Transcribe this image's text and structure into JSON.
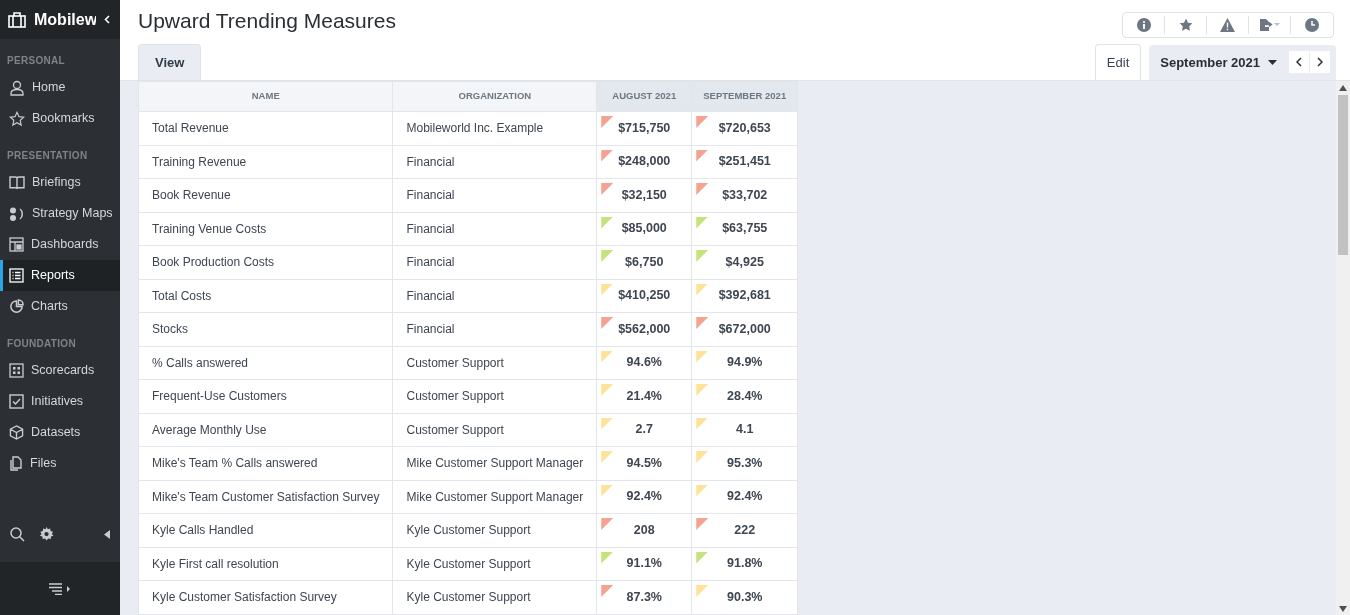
{
  "sidebar": {
    "brand": "Mobilew",
    "sections": [
      {
        "title": "PERSONAL",
        "items": [
          {
            "label": "Home",
            "selected": false
          },
          {
            "label": "Bookmarks",
            "selected": false
          }
        ]
      },
      {
        "title": "PRESENTATION",
        "items": [
          {
            "label": "Briefings",
            "selected": false
          },
          {
            "label": "Strategy Maps",
            "selected": false
          },
          {
            "label": "Dashboards",
            "selected": false
          },
          {
            "label": "Reports",
            "selected": true
          },
          {
            "label": "Charts",
            "selected": false
          }
        ]
      },
      {
        "title": "FOUNDATION",
        "items": [
          {
            "label": "Scorecards",
            "selected": false
          },
          {
            "label": "Initiatives",
            "selected": false
          },
          {
            "label": "Datasets",
            "selected": false
          },
          {
            "label": "Files",
            "selected": false
          }
        ]
      }
    ]
  },
  "page": {
    "title": "Upward Trending Measures"
  },
  "tabs": [
    {
      "label": "View",
      "selected": true
    }
  ],
  "edit_button": "Edit",
  "period": "September 2021",
  "table": {
    "columns": [
      "NAME",
      "ORGANIZATION",
      "AUGUST 2021",
      "SEPTEMBER 2021"
    ],
    "rows": [
      {
        "name": "Total Revenue",
        "organization": "Mobileworld Inc. Example",
        "values": [
          {
            "value": "$715,750",
            "color": "#f4a392"
          },
          {
            "value": "$720,653",
            "color": "#f4a392"
          }
        ]
      },
      {
        "name": "Training Revenue",
        "organization": "Financial",
        "values": [
          {
            "value": "$248,000",
            "color": "#f4a392"
          },
          {
            "value": "$251,451",
            "color": "#f4a392"
          }
        ]
      },
      {
        "name": "Book Revenue",
        "organization": "Financial",
        "values": [
          {
            "value": "$32,150",
            "color": "#f4a392"
          },
          {
            "value": "$33,702",
            "color": "#f4a392"
          }
        ]
      },
      {
        "name": "Training Venue Costs",
        "organization": "Financial",
        "values": [
          {
            "value": "$85,000",
            "color": "#c6e27a"
          },
          {
            "value": "$63,755",
            "color": "#c6e27a"
          }
        ]
      },
      {
        "name": "Book Production Costs",
        "organization": "Financial",
        "values": [
          {
            "value": "$6,750",
            "color": "#c6e27a"
          },
          {
            "value": "$4,925",
            "color": "#c6e27a"
          }
        ]
      },
      {
        "name": "Total Costs",
        "organization": "Financial",
        "values": [
          {
            "value": "$410,250",
            "color": "#fde39a"
          },
          {
            "value": "$392,681",
            "color": "#fde39a"
          }
        ]
      },
      {
        "name": "Stocks",
        "organization": "Financial",
        "values": [
          {
            "value": "$562,000",
            "color": "#f4a392"
          },
          {
            "value": "$672,000",
            "color": "#f4a392"
          }
        ]
      },
      {
        "name": "% Calls answered",
        "organization": "Customer Support",
        "values": [
          {
            "value": "94.6%",
            "color": "#fde39a"
          },
          {
            "value": "94.9%",
            "color": "#fde39a"
          }
        ]
      },
      {
        "name": "Frequent-Use Customers",
        "organization": "Customer Support",
        "values": [
          {
            "value": "21.4%",
            "color": "#fde39a"
          },
          {
            "value": "28.4%",
            "color": "#fde39a"
          }
        ]
      },
      {
        "name": "Average Monthly Use",
        "organization": "Customer Support",
        "values": [
          {
            "value": "2.7",
            "color": "#fde39a"
          },
          {
            "value": "4.1",
            "color": "#fde39a"
          }
        ]
      },
      {
        "name": "Mike's Team % Calls answered",
        "organization": "Mike Customer Support Manager",
        "values": [
          {
            "value": "94.5%",
            "color": "#fde39a"
          },
          {
            "value": "95.3%",
            "color": "#fde39a"
          }
        ]
      },
      {
        "name": "Mike's Team Customer Satisfaction Survey",
        "organization": "Mike Customer Support Manager",
        "values": [
          {
            "value": "92.4%",
            "color": "#fde39a"
          },
          {
            "value": "92.4%",
            "color": "#fde39a"
          }
        ]
      },
      {
        "name": "Kyle Calls Handled",
        "organization": "Kyle Customer Support",
        "values": [
          {
            "value": "208",
            "color": "#f4a392"
          },
          {
            "value": "222",
            "color": "#f4a392"
          }
        ]
      },
      {
        "name": "Kyle First call resolution",
        "organization": "Kyle Customer Support",
        "values": [
          {
            "value": "91.1%",
            "color": "#c6e27a"
          },
          {
            "value": "91.8%",
            "color": "#c6e27a"
          }
        ]
      },
      {
        "name": "Kyle Customer Satisfaction Survey",
        "organization": "Kyle Customer Support",
        "values": [
          {
            "value": "87.3%",
            "color": "#f4a392"
          },
          {
            "value": "90.3%",
            "color": "#fde39a"
          }
        ]
      }
    ]
  }
}
